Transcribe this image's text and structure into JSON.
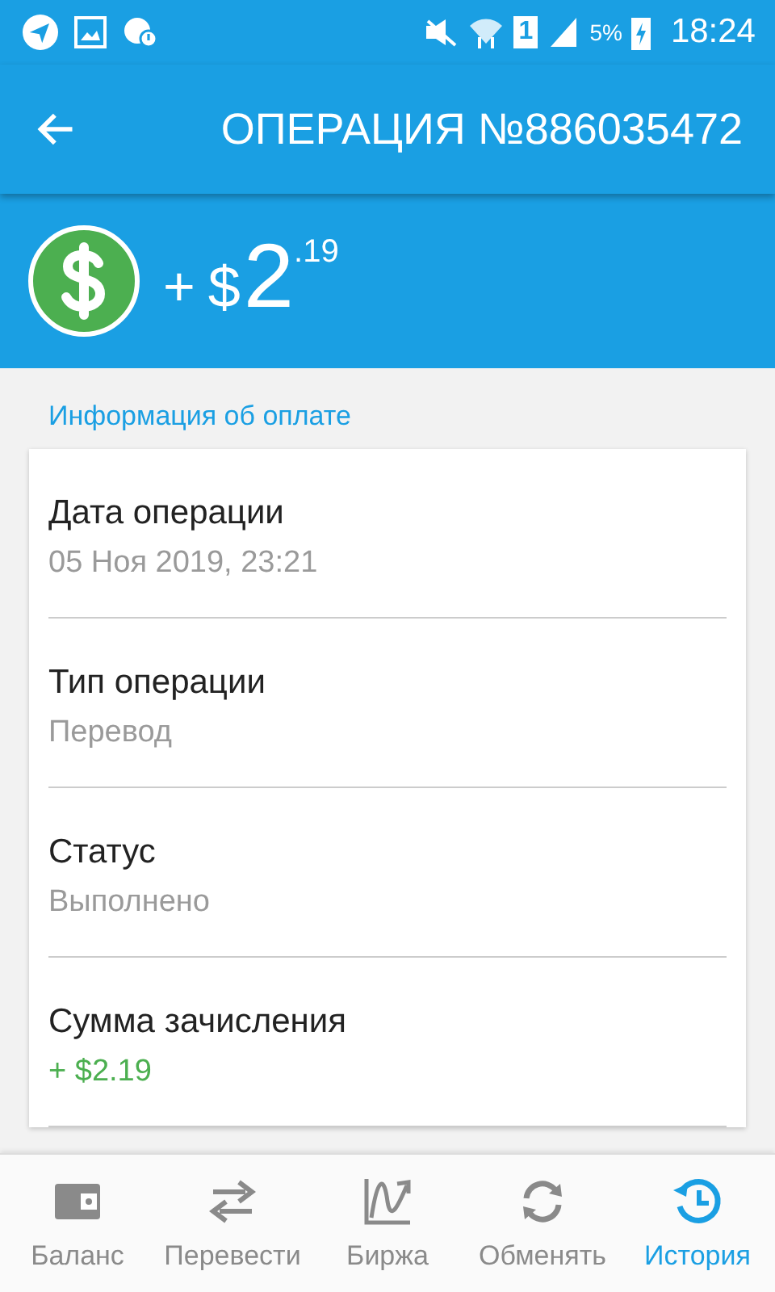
{
  "status_bar": {
    "sim": "1",
    "battery": "5%",
    "time": "18:24"
  },
  "app_bar": {
    "title": "ОПЕРАЦИЯ №886035472"
  },
  "header": {
    "sign": "+",
    "currency": "$",
    "amount": "2",
    "cents": ".19"
  },
  "section_title": "Информация об оплате",
  "fields": [
    {
      "label": "Дата операции",
      "value": "05 Ноя 2019, 23:21",
      "kind": "plain"
    },
    {
      "label": "Тип операции",
      "value": "Перевод",
      "kind": "plain"
    },
    {
      "label": "Статус",
      "value": "Выполнено",
      "kind": "plain"
    },
    {
      "label": "Сумма зачисления",
      "value": "+ $2.19",
      "kind": "amount"
    }
  ],
  "nav": [
    {
      "label": "Баланс",
      "selected": false
    },
    {
      "label": "Перевести",
      "selected": false
    },
    {
      "label": "Биржа",
      "selected": false
    },
    {
      "label": "Обменять",
      "selected": false
    },
    {
      "label": "История",
      "selected": true
    }
  ]
}
